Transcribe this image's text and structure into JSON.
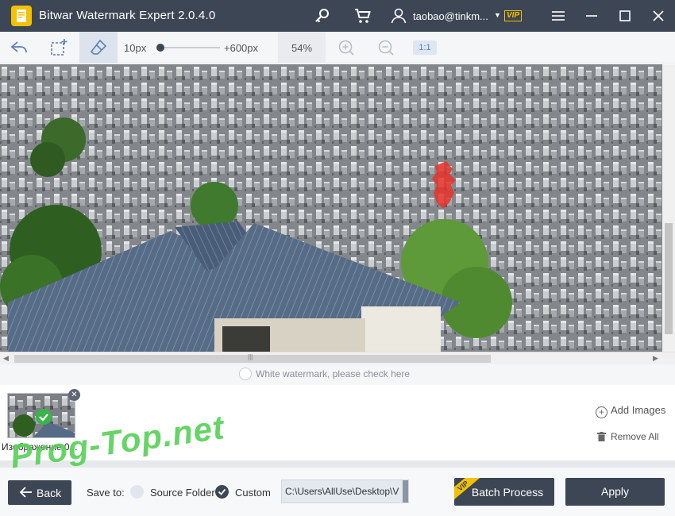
{
  "titlebar": {
    "title": "Bitwar Watermark Expert  2.0.4.0",
    "user": "taobao@tinkm...",
    "vip": "VIP",
    "icons": [
      "key-icon",
      "cart-icon",
      "user-icon",
      "menu-icon",
      "minimize-icon",
      "maximize-icon",
      "close-icon"
    ]
  },
  "toolbar": {
    "brush_min": "10px",
    "brush_max": "+600px",
    "brush_level": 0.03,
    "zoom": "54%",
    "one_to_one": "1:1",
    "tools": [
      "undo-icon",
      "rectangle-select-icon",
      "eraser-icon",
      "zoom-in-icon",
      "zoom-out-icon"
    ]
  },
  "canvas": {
    "white_watermark_label": "White watermark, please check here"
  },
  "thumbnails": {
    "items": [
      {
        "name": "Изображение 0..."
      }
    ],
    "add_images": "Add Images",
    "remove_all": "Remove All"
  },
  "bottombar": {
    "back": "Back",
    "save_to": "Save to:",
    "source_folder": "Source Folder",
    "custom": "Custom",
    "path": "C:\\Users\\AllUse\\Desktop\\V",
    "batch_process": "Batch Process",
    "batch_vip": "VIP",
    "apply": "Apply"
  },
  "overlay": {
    "watermark_text": "Prog-Top.net"
  },
  "colors": {
    "titlebar": "#3d4654",
    "accent": "#f2c100",
    "check": "#39b54a",
    "toolbar_bg": "#f5f6f8"
  }
}
